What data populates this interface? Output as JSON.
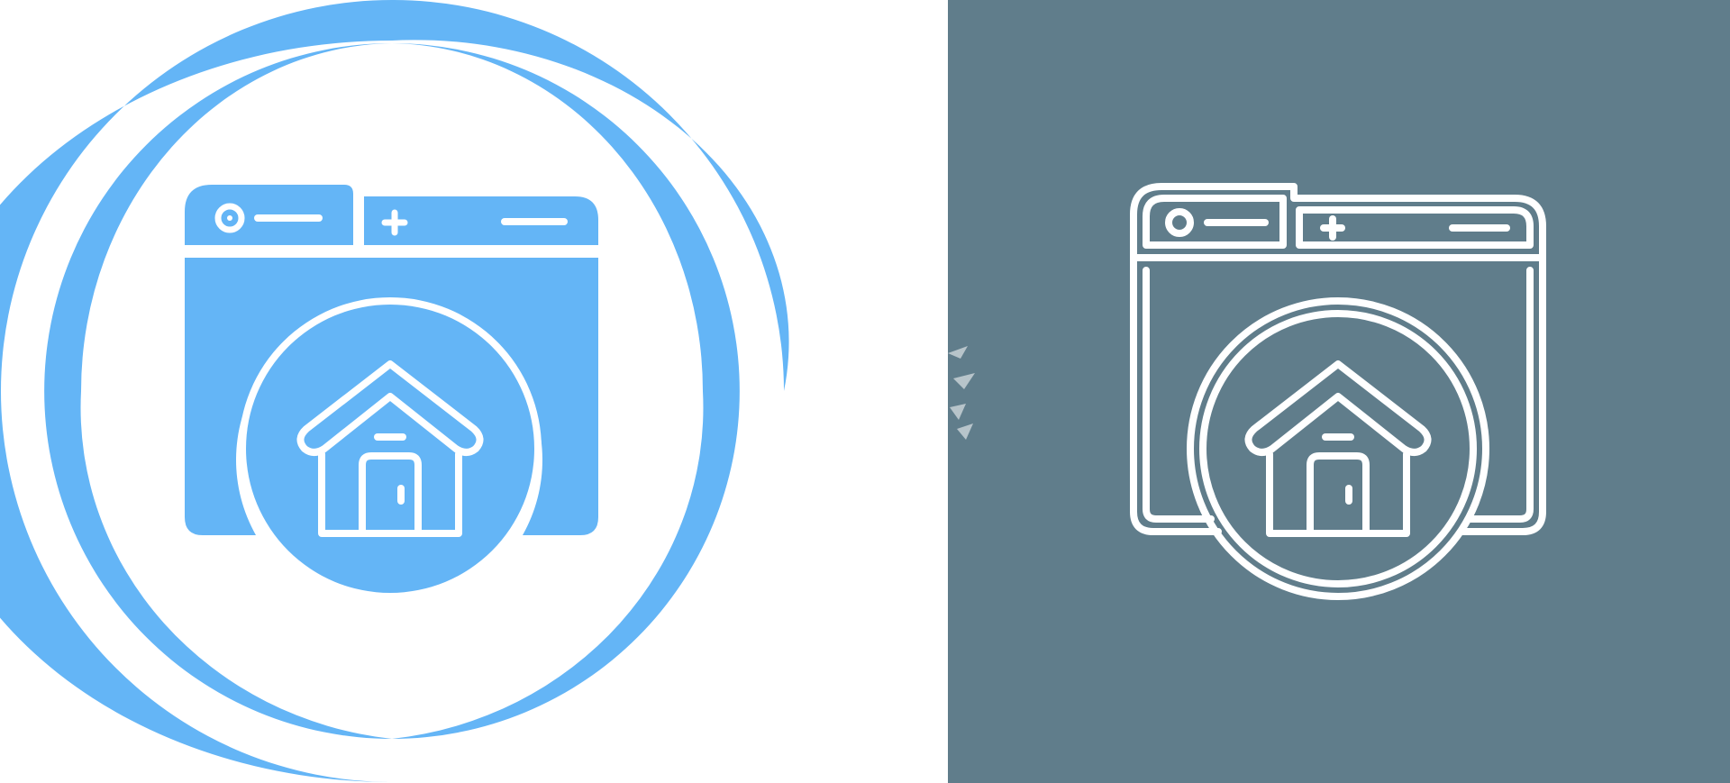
{
  "scene": {
    "description_free": true
  },
  "colors": {
    "background_left": "#ffffff",
    "background_right": "#607d8b",
    "accent_blue": "#64b5f6",
    "outline_white": "#ffffff"
  },
  "icons": {
    "left_variant": "browser-home-icon-filled",
    "right_variant": "browser-home-icon-outline"
  }
}
